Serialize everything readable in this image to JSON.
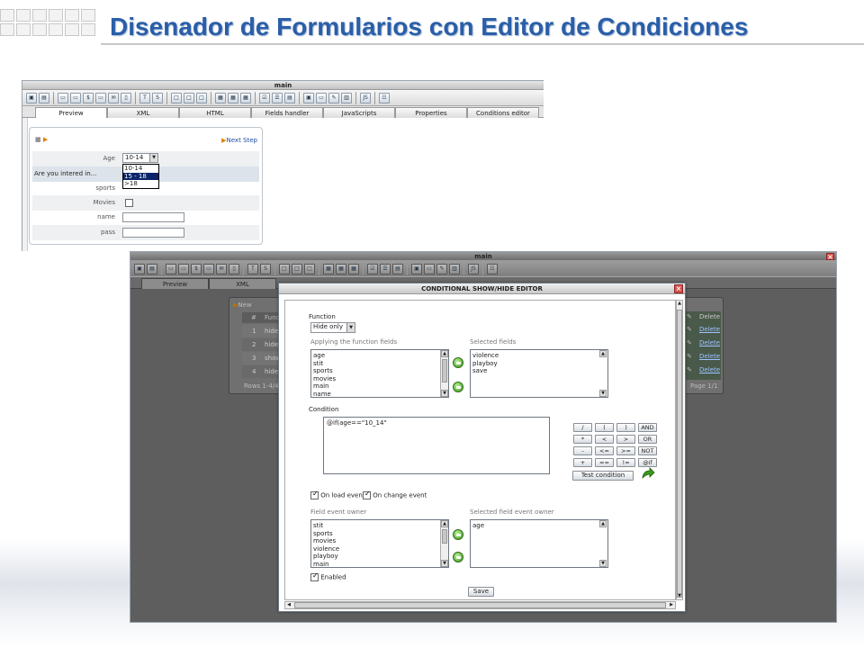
{
  "slide": {
    "title": "Disenador de Formularios con Editor de Condiciones"
  },
  "window1": {
    "title": "main",
    "tabs": [
      "Preview",
      "XML",
      "HTML",
      "Fields handler",
      "JavaScripts",
      "Properties",
      "Conditions editor"
    ],
    "next_step": "Next Step",
    "age_label": "Age",
    "age_value": "10-14",
    "age_options": [
      "10-14",
      "15 - 18",
      ">18"
    ],
    "interest_label": "Are you intered in...",
    "sports_label": "sports",
    "movies_label": "Movies",
    "name_label": "name",
    "pass_label": "pass"
  },
  "window2": {
    "title": "main",
    "tabs": [
      "Preview",
      "XML"
    ],
    "new_label": "New",
    "grid_header": [
      "#",
      "Functi"
    ],
    "rows": [
      {
        "num": "1",
        "func": "hideO"
      },
      {
        "num": "2",
        "func": "hideO"
      },
      {
        "num": "3",
        "func": "show"
      },
      {
        "num": "4",
        "func": "hide"
      }
    ],
    "delete_header": "Delete",
    "delete_link": "Delete",
    "rows_info": "Rows 1-4/4",
    "page_info": "Page 1/1"
  },
  "dialog": {
    "title": "CONDITIONAL SHOW/HIDE EDITOR",
    "function_label": "Function",
    "function_value": "Hide only",
    "applying_label": "Applying the function fields",
    "applying_items": [
      "age",
      "stit",
      "sports",
      "movies",
      "main",
      "name"
    ],
    "selected_label": "Selected fields",
    "selected_items": [
      "violence",
      "playboy",
      "save"
    ],
    "condition_label": "Condition",
    "condition_text": "@if(age==\"10_14\"",
    "operators": [
      "/",
      "(",
      ")",
      "AND",
      "*",
      "<",
      ">",
      "OR",
      "-",
      "<=",
      ">=",
      "NOT",
      "+",
      "==",
      "!=",
      "@if"
    ],
    "test_button": "Test condition",
    "on_load_label": "On load event",
    "on_change_label": "On change event",
    "owner_label": "Field event owner",
    "owner_items": [
      "stit",
      "sports",
      "movies",
      "violence",
      "playboy",
      "main"
    ],
    "selected_owner_label": "Selected field event owner",
    "selected_owner_items": [
      "age"
    ],
    "enabled_label": "Enabled",
    "save_button": "Save"
  },
  "colors": {
    "title": "#2a5ea8",
    "selection": "#0a246a",
    "dark_bg": "#5e5e5e"
  }
}
